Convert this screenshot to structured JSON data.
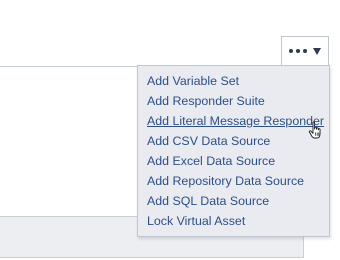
{
  "toolbar": {
    "more_button": {
      "icon": "ellipsis-icon",
      "dropdown_icon": "caret-down-icon"
    }
  },
  "menu": {
    "items": [
      {
        "label": "Add Variable Set"
      },
      {
        "label": "Add Responder Suite"
      },
      {
        "label": "Add Literal Message Responder",
        "state": "hover"
      },
      {
        "label": "Add CSV Data Source"
      },
      {
        "label": "Add Excel Data Source"
      },
      {
        "label": "Add Repository Data Source"
      },
      {
        "label": "Add SQL Data Source"
      },
      {
        "label": "Lock Virtual Asset"
      }
    ]
  },
  "colors": {
    "link": "#2d4f86",
    "menu_bg": "#e9ebf1",
    "border": "#bfc6d0"
  },
  "cursor": {
    "icon": "hand-pointer-icon"
  }
}
